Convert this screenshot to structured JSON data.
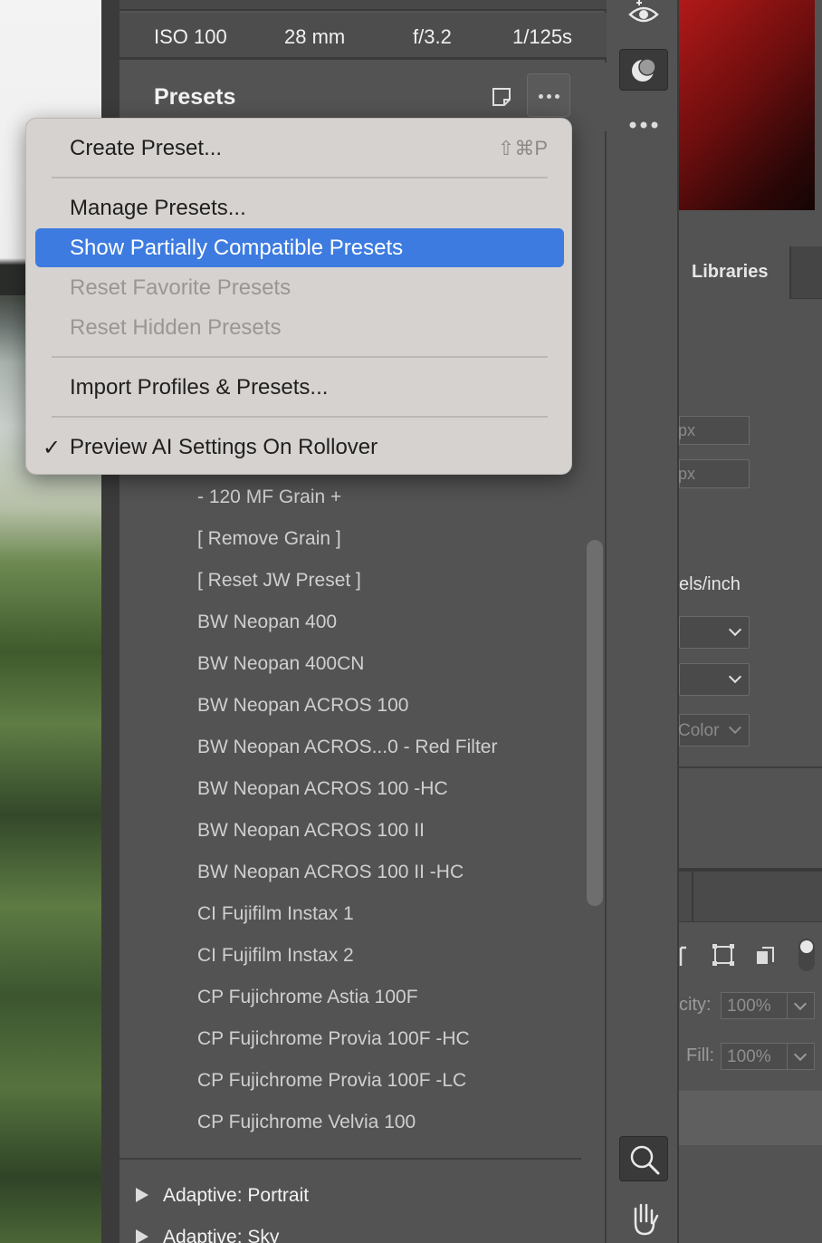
{
  "exif": {
    "iso": "ISO 100",
    "focal": "28 mm",
    "aperture": "f/3.2",
    "shutter": "1/125s"
  },
  "presets_panel": {
    "title": "Presets",
    "items": [
      "- 120 MF Grain +",
      "[ Remove Grain ]",
      "[ Reset JW Preset ]",
      "BW Neopan 400",
      "BW Neopan 400CN",
      "BW Neopan ACROS 100",
      "BW Neopan ACROS...0 - Red Filter",
      "BW Neopan ACROS 100 -HC",
      "BW Neopan ACROS 100 II",
      "BW Neopan ACROS 100 II -HC",
      "CI Fujifilm Instax 1",
      "CI Fujifilm Instax 2",
      "CP Fujichrome Astia 100F",
      "CP Fujichrome Provia 100F -HC",
      "CP Fujichrome Provia 100F -LC",
      "CP Fujichrome Velvia 100"
    ],
    "groups": [
      "Adaptive: Portrait",
      "Adaptive: Sky"
    ]
  },
  "menu": {
    "create_preset": "Create Preset...",
    "create_shortcut": "⇧⌘P",
    "manage_presets": "Manage Presets...",
    "show_partial": "Show Partially Compatible Presets",
    "reset_favorite": "Reset Favorite Presets",
    "reset_hidden": "Reset Hidden Presets",
    "import": "Import Profiles & Presets...",
    "preview_ai": "Preview AI Settings On Rollover",
    "check": "✓"
  },
  "right_panel": {
    "tab_label": "Libraries",
    "unit_px_1": "px",
    "unit_px_2": "px",
    "resolution_unit": "els/inch",
    "color_mode": "Color",
    "opacity_label": "city:",
    "opacity_value": "100%",
    "fill_label": "Fill:",
    "fill_value": "100%"
  },
  "colors": {
    "menu_bg": "#d6d2cf",
    "menu_highlight": "#3d7be0",
    "panel_bg": "#535353"
  }
}
